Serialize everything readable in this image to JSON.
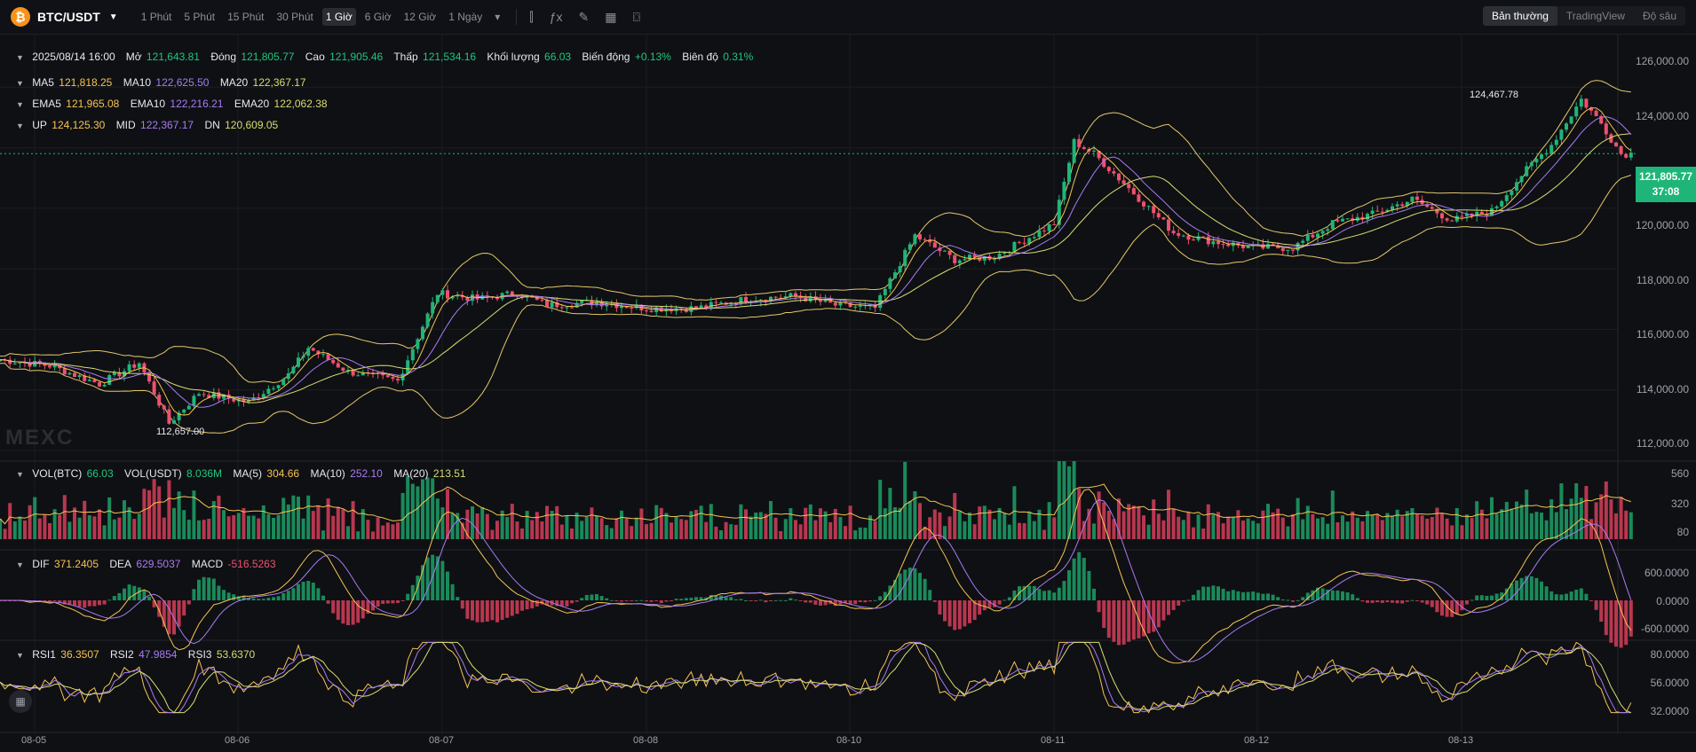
{
  "toolbar": {
    "pair": "BTC/USDT",
    "timeframes": [
      "1 Phút",
      "5 Phút",
      "15 Phút",
      "30 Phút",
      "1 Giờ",
      "6 Giờ",
      "12 Giờ",
      "1 Ngày"
    ],
    "active_timeframe": "1 Giờ",
    "modes": [
      "Bản thường",
      "TradingView",
      "Độ sâu"
    ],
    "active_mode": "Bản thường"
  },
  "ohlc": {
    "date": "2025/08/14 16:00",
    "open_label": "Mở",
    "open": "121,643.81",
    "close_label": "Đóng",
    "close": "121,805.77",
    "high_label": "Cao",
    "high": "121,905.46",
    "low_label": "Thấp",
    "low": "121,534.16",
    "vol_label": "Khối lượng",
    "vol": "66.03",
    "change_label": "Biến động",
    "change": "+0.13%",
    "amp_label": "Biên độ",
    "amp": "0.31%"
  },
  "ma": {
    "ma5_label": "MA5",
    "ma5": "121,818.25",
    "ma10_label": "MA10",
    "ma10": "122,625.50",
    "ma20_label": "MA20",
    "ma20": "122,367.17"
  },
  "ema": {
    "ema5_label": "EMA5",
    "ema5": "121,965.08",
    "ema10_label": "EMA10",
    "ema10": "122,216.21",
    "ema20_label": "EMA20",
    "ema20": "122,062.38"
  },
  "boll": {
    "up_label": "UP",
    "up": "124,125.30",
    "mid_label": "MID",
    "mid": "122,367.17",
    "dn_label": "DN",
    "dn": "120,609.05"
  },
  "vol_legend": {
    "btc_label": "VOL(BTC)",
    "btc": "66.03",
    "usdt_label": "VOL(USDT)",
    "usdt": "8.036M",
    "ma5_label": "MA(5)",
    "ma5": "304.66",
    "ma10_label": "MA(10)",
    "ma10": "252.10",
    "ma20_label": "MA(20)",
    "ma20": "213.51"
  },
  "macd_legend": {
    "dif_label": "DIF",
    "dif": "371.2405",
    "dea_label": "DEA",
    "dea": "629.5037",
    "macd_label": "MACD",
    "macd": "-516.5263"
  },
  "rsi_legend": {
    "rsi1_label": "RSI1",
    "rsi1": "36.3507",
    "rsi2_label": "RSI2",
    "rsi2": "47.9854",
    "rsi3_label": "RSI3",
    "rsi3": "53.6370"
  },
  "price_axis": [
    "126,000.00",
    "124,000.00",
    "122,000.00",
    "120,000.00",
    "118,000.00",
    "116,000.00",
    "114,000.00",
    "112,000.00"
  ],
  "current_price": "121,805.77",
  "countdown": "37:08",
  "vol_axis": [
    "560",
    "320",
    "80"
  ],
  "macd_axis": [
    "600.0000",
    "0.0000",
    "-600.0000"
  ],
  "rsi_axis": [
    "80.0000",
    "56.0000",
    "32.0000"
  ],
  "dates": [
    "08-05",
    "08-06",
    "08-07",
    "08-08",
    "08-10",
    "08-11",
    "08-12",
    "08-13"
  ],
  "high_annotation": "124,467.78",
  "low_annotation": "112,657.00",
  "watermark": "MEXC",
  "colors": {
    "up": "#1fb579",
    "down": "#f0506e",
    "ma5": "#f5c451",
    "ma10": "#a77cf2",
    "ma20": "#d7dd6e",
    "boll": "#e3c86a"
  },
  "chart_data": {
    "type": "candlestick",
    "interval": "1h",
    "price_axis_range": [
      112000,
      126000
    ],
    "anchor_prices": [
      [
        0,
        115000
      ],
      [
        10,
        114800
      ],
      [
        20,
        114200
      ],
      [
        28,
        114900
      ],
      [
        34,
        112900
      ],
      [
        40,
        113900
      ],
      [
        50,
        113600
      ],
      [
        58,
        114500
      ],
      [
        62,
        115400
      ],
      [
        70,
        114600
      ],
      [
        80,
        114300
      ],
      [
        88,
        117200
      ],
      [
        96,
        117000
      ],
      [
        104,
        117200
      ],
      [
        110,
        116800
      ],
      [
        120,
        116900
      ],
      [
        130,
        116700
      ],
      [
        140,
        116700
      ],
      [
        150,
        117000
      ],
      [
        160,
        117100
      ],
      [
        168,
        116800
      ],
      [
        176,
        116700
      ],
      [
        184,
        119100
      ],
      [
        192,
        118300
      ],
      [
        200,
        118400
      ],
      [
        212,
        119500
      ],
      [
        216,
        122200
      ],
      [
        220,
        121800
      ],
      [
        228,
        120500
      ],
      [
        236,
        119200
      ],
      [
        244,
        118900
      ],
      [
        252,
        118700
      ],
      [
        260,
        118700
      ],
      [
        268,
        119500
      ],
      [
        276,
        119800
      ],
      [
        284,
        120300
      ],
      [
        292,
        119600
      ],
      [
        300,
        119900
      ],
      [
        306,
        121100
      ],
      [
        312,
        122100
      ],
      [
        318,
        123600
      ],
      [
        322,
        122800
      ],
      [
        326,
        121800
      ],
      [
        328,
        121806
      ]
    ]
  }
}
